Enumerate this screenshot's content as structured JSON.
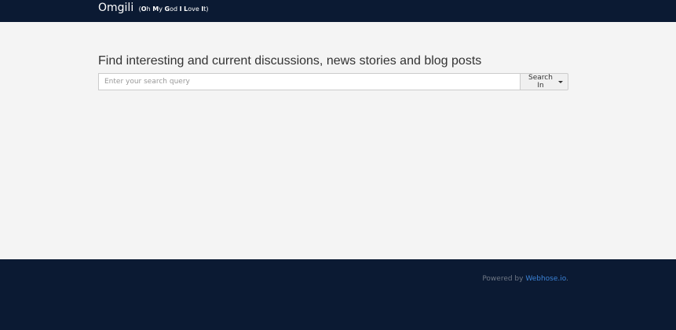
{
  "header": {
    "brand_name": "Omgili",
    "brand_tagline_parts": [
      {
        "text": "(",
        "bold": false
      },
      {
        "text": "O",
        "bold": true
      },
      {
        "text": "h ",
        "bold": false
      },
      {
        "text": "M",
        "bold": true
      },
      {
        "text": "y ",
        "bold": false
      },
      {
        "text": "G",
        "bold": true
      },
      {
        "text": "od ",
        "bold": false
      },
      {
        "text": "I",
        "bold": true
      },
      {
        "text": " ",
        "bold": false
      },
      {
        "text": "L",
        "bold": true
      },
      {
        "text": "ove ",
        "bold": false
      },
      {
        "text": "I",
        "bold": true
      },
      {
        "text": "t)",
        "bold": false
      }
    ]
  },
  "main": {
    "headline": "Find interesting and current discussions, news stories and blog posts",
    "search": {
      "placeholder": "Enter your search query",
      "value": "",
      "button_label": "Search In"
    }
  },
  "footer": {
    "powered_prefix": "Powered by ",
    "powered_link": "Webhose.io",
    "powered_suffix": "."
  },
  "colors": {
    "header_bg": "#0b1a33",
    "footer_bg": "#0b1a33",
    "body_bg": "#f4f4f4",
    "link": "#3b82d6"
  }
}
